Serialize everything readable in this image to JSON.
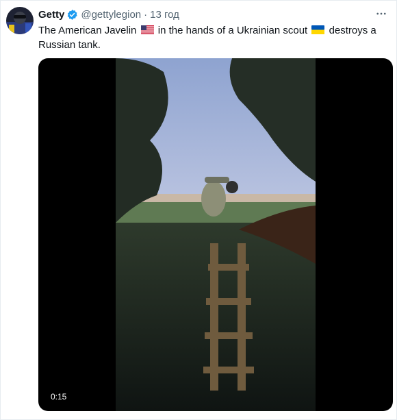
{
  "tweet": {
    "author_name": "Getty",
    "handle": "@gettylegion",
    "separator": "·",
    "timestamp": "13 год",
    "text_parts": [
      "The American Javelin",
      "in the hands of a Ukrainian scout",
      "destroys a Russian tank."
    ],
    "video": {
      "duration": "0:15"
    }
  },
  "colors": {
    "verified": "#1d9bf0",
    "secondary_text": "#536471",
    "primary_text": "#0f1419",
    "media_background": "#000000"
  },
  "icons": {
    "verified": "verified-badge-icon",
    "more": "more-options-icon",
    "us_flag": "us-flag-icon",
    "ukraine_flag": "ukraine-flag-icon"
  }
}
